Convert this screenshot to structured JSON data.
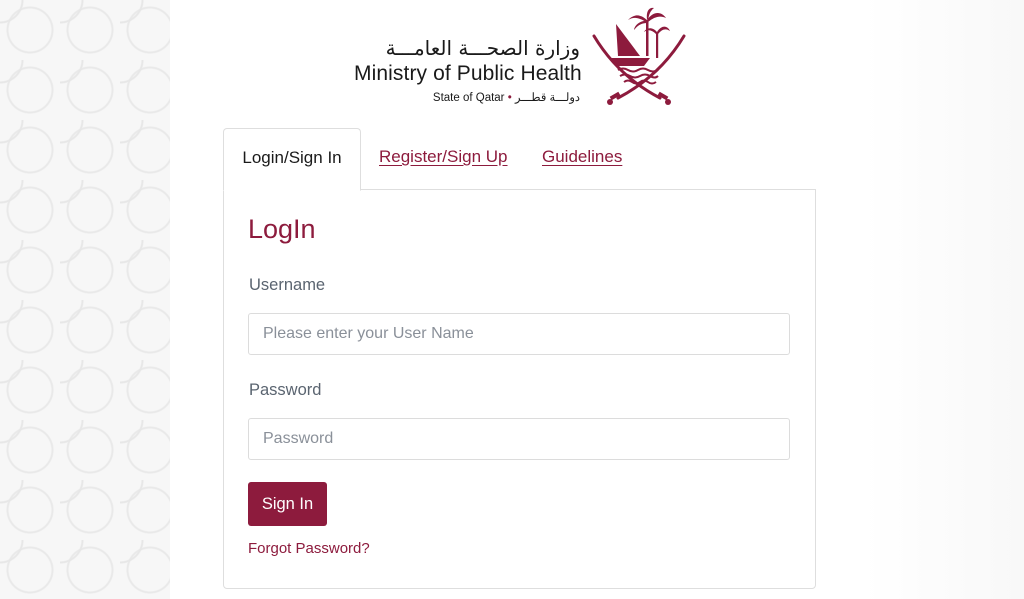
{
  "brand": {
    "arabic_name": "وزارة الصحـــة العامـــة",
    "english_name": "Ministry of Public Health",
    "state_en": "State of Qatar",
    "state_ar": "دولـــة قطـــر",
    "emblem_icon": "qatar-state-emblem-icon"
  },
  "tabs": [
    {
      "label": "Login/Sign In",
      "active": true
    },
    {
      "label": "Register/Sign Up",
      "active": false
    },
    {
      "label": "Guidelines",
      "active": false
    }
  ],
  "login": {
    "title": "LogIn",
    "username_label": "Username",
    "username_placeholder": "Please enter your User Name",
    "username_value": "",
    "password_label": "Password",
    "password_placeholder": "Password",
    "password_value": "",
    "submit_label": "Sign In",
    "forgot_label": "Forgot Password?"
  },
  "colors": {
    "brand_maroon": "#8d1b3d",
    "text_dark": "#1a1a1a",
    "label_gray": "#5a6470",
    "border": "#dedede"
  }
}
